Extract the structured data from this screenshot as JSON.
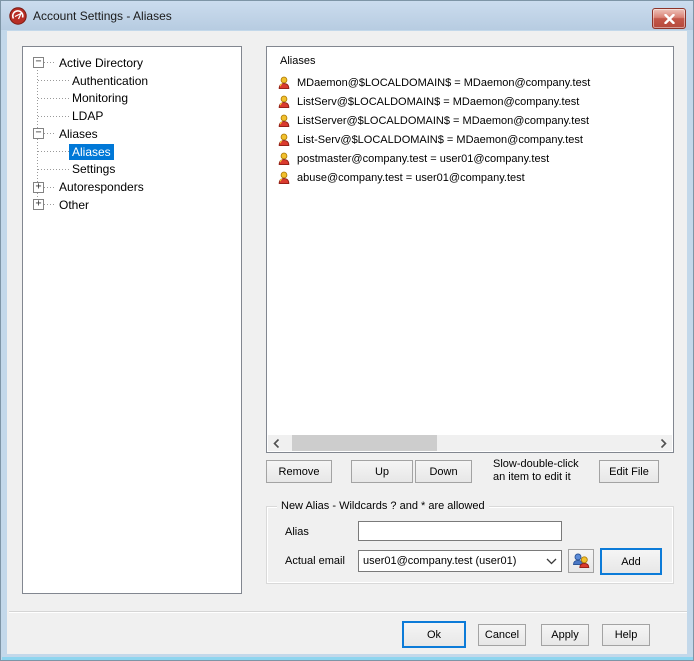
{
  "window": {
    "title": "Account Settings - Aliases",
    "app_icon": "mdaemon-logo-icon",
    "close_icon": "close-icon"
  },
  "colors": {
    "titlebar_top": "#cbdcee",
    "titlebar_bottom": "#b7cce1",
    "frame": "#c3d8ea",
    "dialog_bg": "#f0f0f0",
    "highlight": "#0078d7",
    "close_red": "#c4584a",
    "default_button_border": "#0c7bd8"
  },
  "tree": {
    "items": [
      {
        "label": "Active Directory",
        "level": 0,
        "state": "expanded",
        "selected": false
      },
      {
        "label": "Authentication",
        "level": 1,
        "selected": false
      },
      {
        "label": "Monitoring",
        "level": 1,
        "selected": false
      },
      {
        "label": "LDAP",
        "level": 1,
        "selected": false
      },
      {
        "label": "Aliases",
        "level": 0,
        "state": "expanded",
        "selected": false
      },
      {
        "label": "Aliases",
        "level": 1,
        "selected": true
      },
      {
        "label": "Settings",
        "level": 1,
        "selected": false
      },
      {
        "label": "Autoresponders",
        "level": 0,
        "state": "collapsed",
        "selected": false
      },
      {
        "label": "Other",
        "level": 0,
        "state": "collapsed",
        "selected": false
      }
    ]
  },
  "alias_list": {
    "header": "Aliases",
    "item_icon": "person-icon",
    "items": [
      "MDaemon@$LOCALDOMAIN$ = MDaemon@company.test",
      "ListServ@$LOCALDOMAIN$ = MDaemon@company.test",
      "ListServer@$LOCALDOMAIN$ = MDaemon@company.test",
      "List-Serv@$LOCALDOMAIN$ = MDaemon@company.test",
      "postmaster@company.test = user01@company.test",
      "abuse@company.test = user01@company.test"
    ]
  },
  "list_actions": {
    "remove_label": "Remove",
    "up_label": "Up",
    "down_label": "Down",
    "hint_line1": "Slow-double-click",
    "hint_line2": "an item to edit it",
    "edit_file_label": "Edit File"
  },
  "new_alias": {
    "group_title": "New Alias - Wildcards ? and * are allowed",
    "alias_label": "Alias",
    "alias_value": "",
    "actual_email_label": "Actual email",
    "actual_email_value": "user01@company.test (user01)",
    "account_picker_icon": "contacts-icon",
    "combo_icon": "chevron-down-icon",
    "add_label": "Add"
  },
  "footer": {
    "ok_label": "Ok",
    "cancel_label": "Cancel",
    "apply_label": "Apply",
    "help_label": "Help"
  }
}
